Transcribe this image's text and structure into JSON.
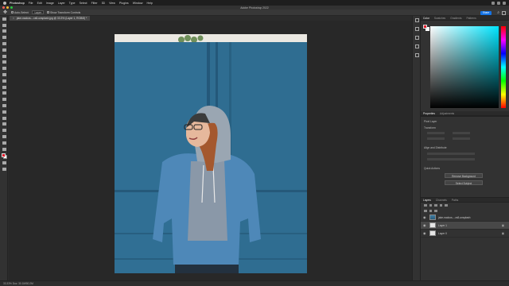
{
  "menubar": {
    "app": "Photoshop",
    "items": [
      "File",
      "Edit",
      "Image",
      "Layer",
      "Type",
      "Select",
      "Filter",
      "3D",
      "View",
      "Plugins",
      "Window",
      "Help"
    ]
  },
  "window": {
    "title": "Adobe Photoshop 2022"
  },
  "options": {
    "auto_select_label": "Auto-Select:",
    "auto_select_value": "Layer",
    "transform_label": "Show Transform Controls",
    "share_label": "Share"
  },
  "document_tab": {
    "label": "jake-nackos-...ra8-unsplash.jpg @ 33.3% (Layer 1, RGB/8) *"
  },
  "status": {
    "text": "33.33%     Doc: 30.1M/50.2M"
  },
  "color_panel": {
    "tabs": [
      "Color",
      "Swatches",
      "Gradients",
      "Patterns"
    ],
    "fg": "#e41c2c",
    "bg": "#ffffff",
    "picked_hue": "#00e5ff"
  },
  "properties_panel": {
    "tabs": [
      "Properties",
      "Adjustments"
    ],
    "pixel_layer_label": "Pixel Layer",
    "transform_label": "Transform",
    "align_label": "Align and Distribute",
    "quick_actions_label": "Quick Actions",
    "remove_bg_label": "Remove Background",
    "select_subject_label": "Select Subject"
  },
  "layers_panel": {
    "tabs": [
      "Layers",
      "Channels",
      "Paths"
    ],
    "layers": [
      {
        "name": "jake-nackos-...ra8-unsplash",
        "type": "photo",
        "selected": false
      },
      {
        "name": "Layer 1",
        "type": "white",
        "selected": true
      },
      {
        "name": "Layer 0",
        "type": "white",
        "selected": false
      }
    ]
  }
}
